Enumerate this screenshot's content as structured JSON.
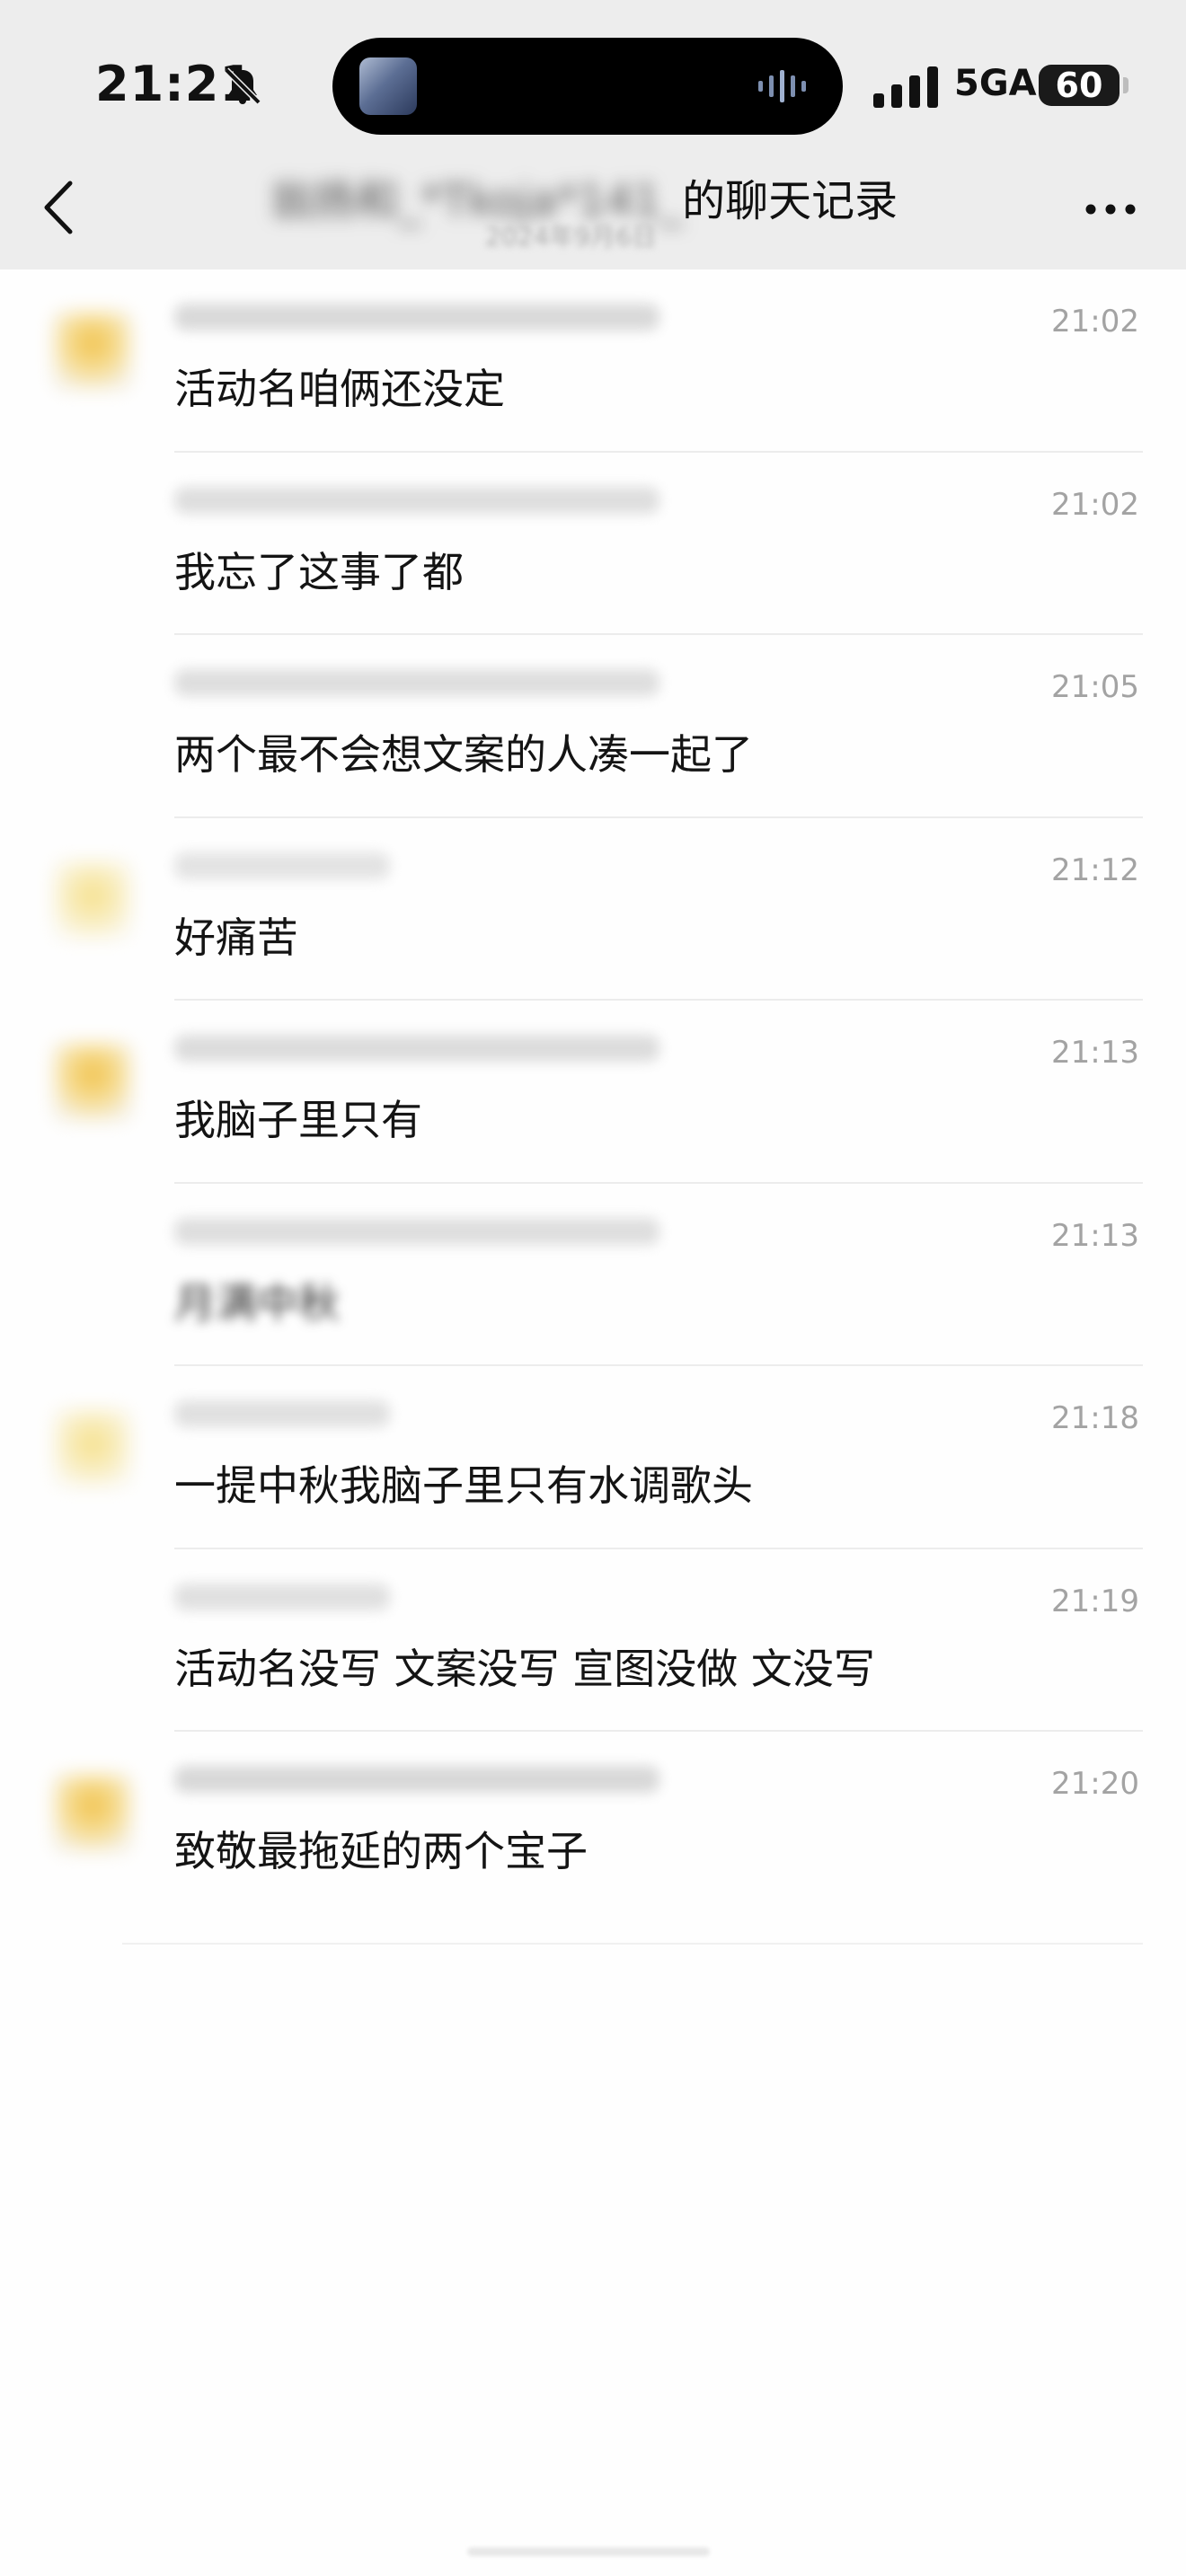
{
  "status_bar": {
    "time": "21:21",
    "network": "5GA",
    "battery": "60"
  },
  "nav": {
    "title_blurred": "翁扬和_*Tkoja*141_",
    "title": "的聊天记录",
    "subtitle_blurred": "2024年9月6日"
  },
  "messages": [
    {
      "time": "21:02",
      "text": "活动名咱俩还没定",
      "blurred": false,
      "avatar": "a",
      "sender_width": 540,
      "sender_color": "#d9d9d9"
    },
    {
      "time": "21:02",
      "text": "我忘了这事了都",
      "blurred": false,
      "avatar": "",
      "sender_width": 540,
      "sender_color": "#dedede"
    },
    {
      "time": "21:05",
      "text": "两个最不会想文案的人凑一起了",
      "blurred": false,
      "avatar": "",
      "sender_width": 540,
      "sender_color": "#dedede"
    },
    {
      "time": "21:12",
      "text": "好痛苦",
      "blurred": false,
      "avatar": "b",
      "sender_width": 240,
      "sender_color": "#e3e3e3"
    },
    {
      "time": "21:13",
      "text": "我脑子里只有",
      "blurred": false,
      "avatar": "a",
      "sender_width": 540,
      "sender_color": "#dcdcdc"
    },
    {
      "time": "21:13",
      "text": "月满中秋",
      "blurred": true,
      "avatar": "",
      "sender_width": 540,
      "sender_color": "#dedede"
    },
    {
      "time": "21:18",
      "text": "一提中秋我脑子里只有水调歌头",
      "blurred": false,
      "avatar": "b",
      "sender_width": 240,
      "sender_color": "#e0e0e0"
    },
    {
      "time": "21:19",
      "text": "活动名没写 文案没写 宣图没做 文没写",
      "blurred": false,
      "avatar": "",
      "sender_width": 240,
      "sender_color": "#e0e0e0"
    },
    {
      "time": "21:20",
      "text": "致敬最拖延的两个宝子",
      "blurred": false,
      "avatar": "a",
      "sender_width": 540,
      "sender_color": "#d8d8d8"
    }
  ]
}
